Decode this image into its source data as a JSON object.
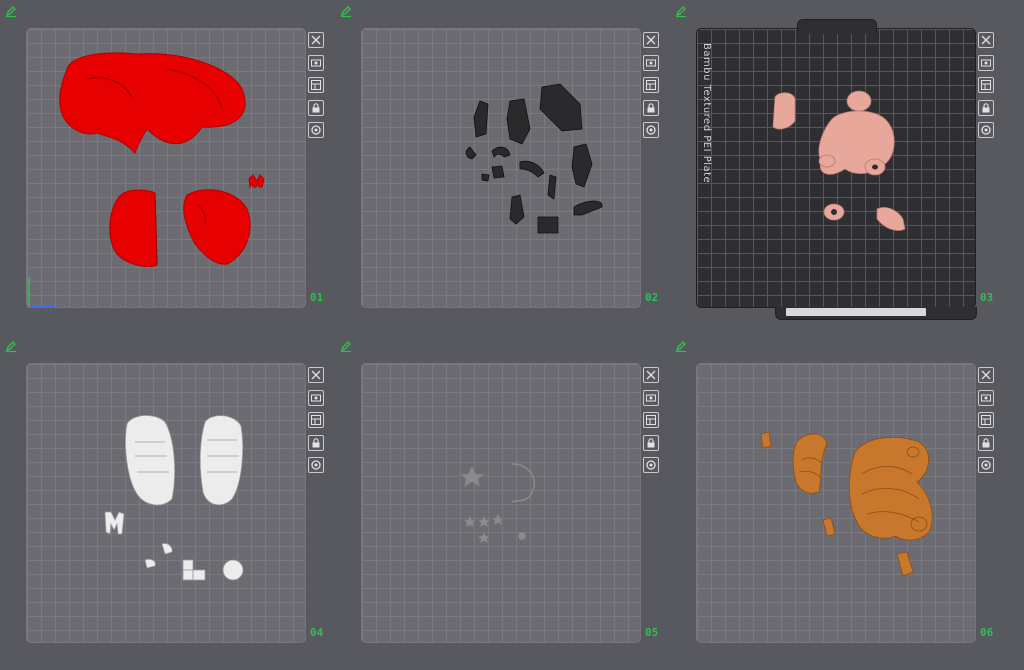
{
  "plates": [
    {
      "number": "01",
      "theme": "light",
      "toolbar": [
        "close-icon",
        "arrange-icon",
        "layout-icon",
        "lock-icon",
        "settings-icon"
      ]
    },
    {
      "number": "02",
      "theme": "light",
      "toolbar": [
        "close-icon",
        "arrange-icon",
        "layout-icon",
        "lock-icon",
        "settings-icon"
      ]
    },
    {
      "number": "03",
      "theme": "dark",
      "label": "Bambu Textured PEI Plate",
      "bottom_text": "",
      "toolbar": [
        "close-icon",
        "arrange-icon",
        "layout-icon",
        "lock-icon",
        "settings-icon"
      ]
    },
    {
      "number": "04",
      "theme": "light",
      "toolbar": [
        "close-icon",
        "arrange-icon",
        "layout-icon",
        "lock-icon",
        "settings-icon"
      ]
    },
    {
      "number": "05",
      "theme": "light",
      "toolbar": [
        "close-icon",
        "arrange-icon",
        "layout-icon",
        "lock-icon",
        "settings-icon"
      ]
    },
    {
      "number": "06",
      "theme": "light",
      "toolbar": [
        "close-icon",
        "arrange-icon",
        "layout-icon",
        "lock-icon",
        "settings-icon"
      ]
    }
  ],
  "colors": {
    "background": "#58585f",
    "plate_number": "#2fbf52",
    "edit_icon": "#2fbf52",
    "part_red": "#e60000",
    "part_black": "#2a2a2c",
    "part_pink": "#e7a79a",
    "part_white": "#ececec",
    "part_gray": "#8a8a8f",
    "part_orange": "#c7782c"
  }
}
